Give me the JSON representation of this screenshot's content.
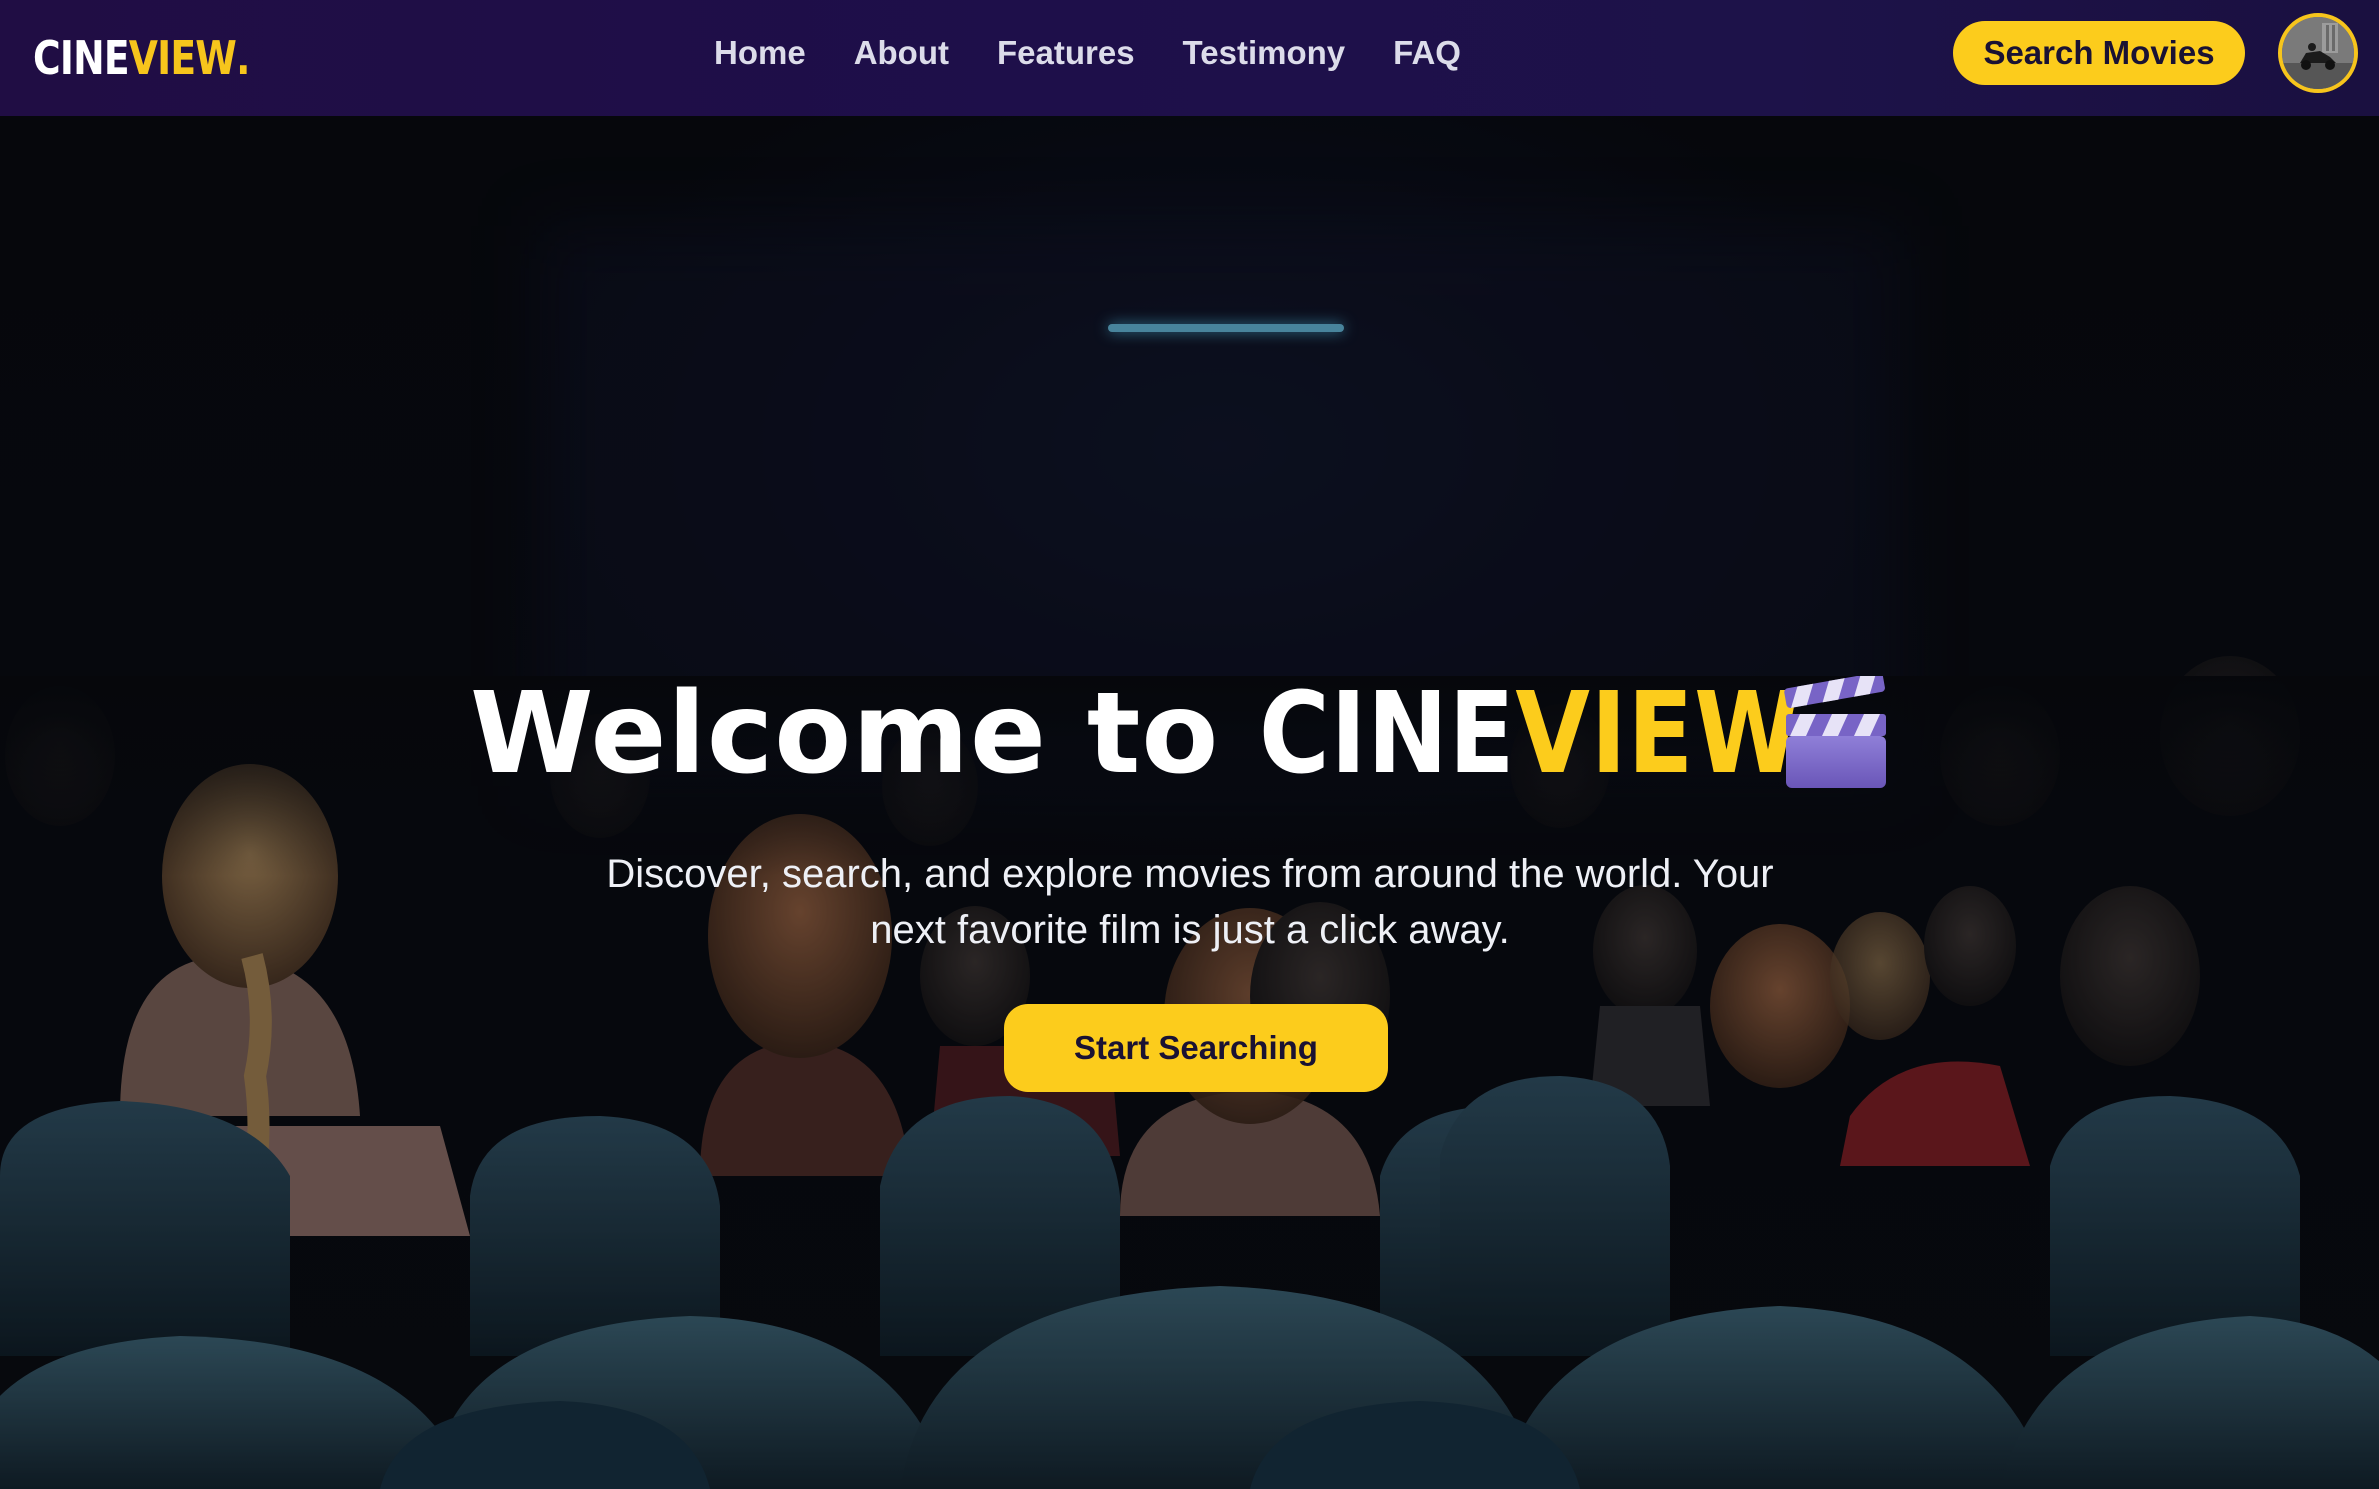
{
  "brand": {
    "logo_white": "CINE",
    "logo_yellow": "VIEW",
    "logo_dot": ".",
    "accent": "#fccc1c",
    "nav_bg": "#200d44"
  },
  "nav": {
    "links": [
      "Home",
      "About",
      "Features",
      "Testimony",
      "FAQ"
    ],
    "cta_label": "Search Movies"
  },
  "hero": {
    "title_prefix": "Welcome to",
    "title_brand_white": "CINE",
    "title_brand_yellow": "VIEW",
    "title_icon": "clapperboard-icon",
    "subtitle_line1": "Discover, search, and explore movies from around the world. Your",
    "subtitle_line2": "next favorite film is just a click away.",
    "cta_label": "Start Searching"
  },
  "icons": {
    "avatar": "user-avatar",
    "clapper": "clapperboard-icon"
  }
}
